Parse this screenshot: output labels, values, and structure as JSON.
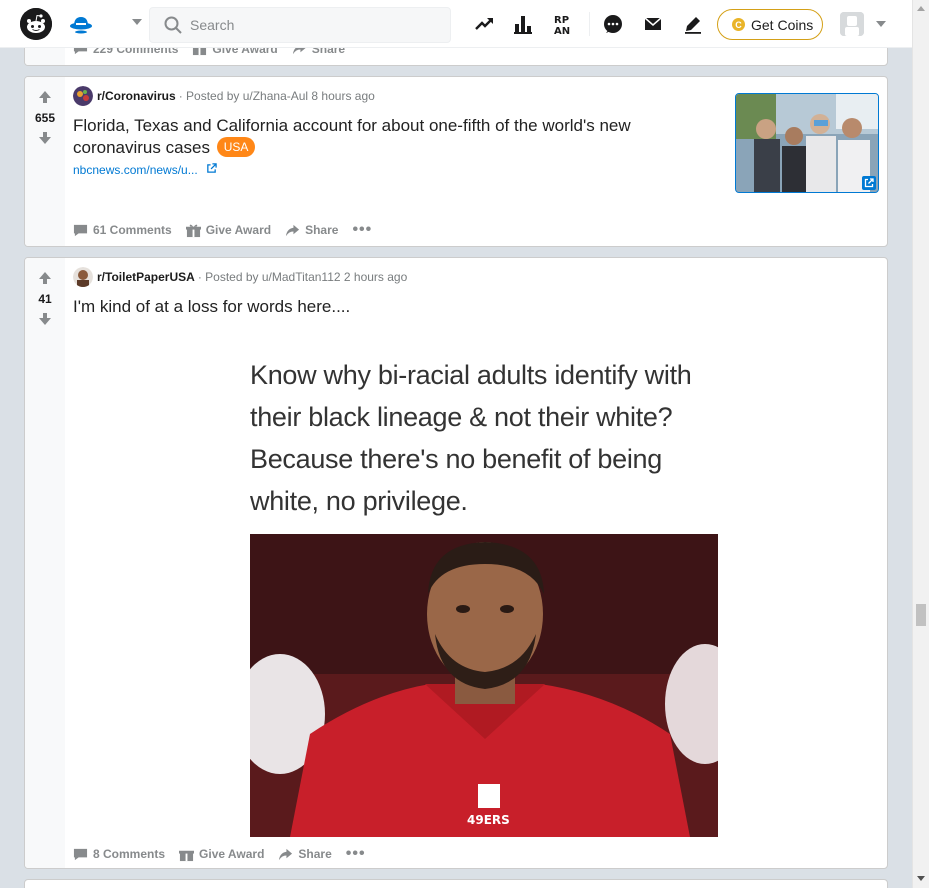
{
  "header": {
    "search_placeholder": "Search",
    "get_coins_label": "Get Coins",
    "coin_symbol": "C",
    "icons": [
      "reddit-logo",
      "home-icon",
      "trending-icon",
      "stats-icon",
      "rpan-icon",
      "chat-icon",
      "mail-icon",
      "pencil-icon",
      "avatar"
    ],
    "rpan_label": "RP AN"
  },
  "top_post_partial": {
    "comments_label": "229 Comments",
    "award_label": "Give Award",
    "share_label": "Share"
  },
  "posts": [
    {
      "score": "655",
      "subreddit": "r/Coronavirus",
      "posted_by": "· Posted by u/Zhana-Aul 8 hours ago",
      "title": "Florida, Texas and California account for about one-fifth of the world's new coronavirus cases",
      "flair": "USA",
      "link": "nbcnews.com/news/u...",
      "comments_label": "61 Comments",
      "award_label": "Give Award",
      "share_label": "Share",
      "more_label": "•••"
    },
    {
      "score": "41",
      "subreddit": "r/ToiletPaperUSA",
      "posted_by": "· Posted by u/MadTitan112 2 hours ago",
      "title": "I'm kind of at a loss for words here....",
      "meme_text": "Know why bi-racial adults identify with their black lineage & not their white? Because there's no benefit of being white, no privilege.",
      "jersey_text": "49ERS",
      "comments_label": "8 Comments",
      "award_label": "Give Award",
      "share_label": "Share",
      "more_label": "•••"
    }
  ],
  "colors": {
    "accent": "#0079d3",
    "flair": "#ff8717",
    "coin_border": "#d4a017",
    "background": "#dae0e6"
  }
}
